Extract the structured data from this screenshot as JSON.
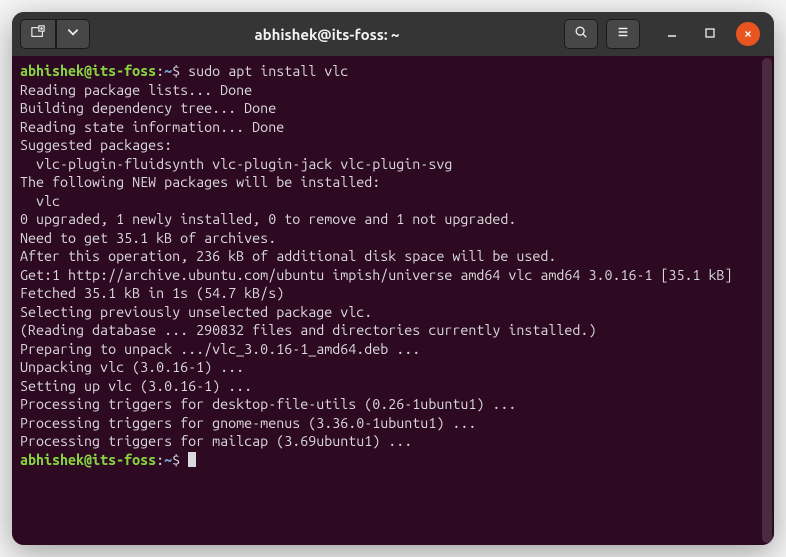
{
  "window": {
    "title": "abhishek@its-foss: ~"
  },
  "prompt": {
    "user_host": "abhishek@its-foss",
    "sep": ":",
    "path": "~",
    "dollar": "$"
  },
  "command": " sudo apt install vlc",
  "output": [
    "Reading package lists... Done",
    "Building dependency tree... Done",
    "Reading state information... Done",
    "Suggested packages:",
    "  vlc-plugin-fluidsynth vlc-plugin-jack vlc-plugin-svg",
    "The following NEW packages will be installed:",
    "  vlc",
    "0 upgraded, 1 newly installed, 0 to remove and 1 not upgraded.",
    "Need to get 35.1 kB of archives.",
    "After this operation, 236 kB of additional disk space will be used.",
    "Get:1 http://archive.ubuntu.com/ubuntu impish/universe amd64 vlc amd64 3.0.16-1 [35.1 kB]",
    "Fetched 35.1 kB in 1s (54.7 kB/s)",
    "Selecting previously unselected package vlc.",
    "(Reading database ... 290832 files and directories currently installed.)",
    "Preparing to unpack .../vlc_3.0.16-1_amd64.deb ...",
    "Unpacking vlc (3.0.16-1) ...",
    "Setting up vlc (3.0.16-1) ...",
    "Processing triggers for desktop-file-utils (0.26-1ubuntu1) ...",
    "Processing triggers for gnome-menus (3.36.0-1ubuntu1) ...",
    "Processing triggers for mailcap (3.69ubuntu1) ..."
  ],
  "icons": {
    "newtab": "new-tab-icon",
    "dropdown": "chevron-down-icon",
    "search": "search-icon",
    "menu": "hamburger-icon",
    "minimize": "minimize-icon",
    "maximize": "maximize-icon",
    "close": "close-icon"
  }
}
